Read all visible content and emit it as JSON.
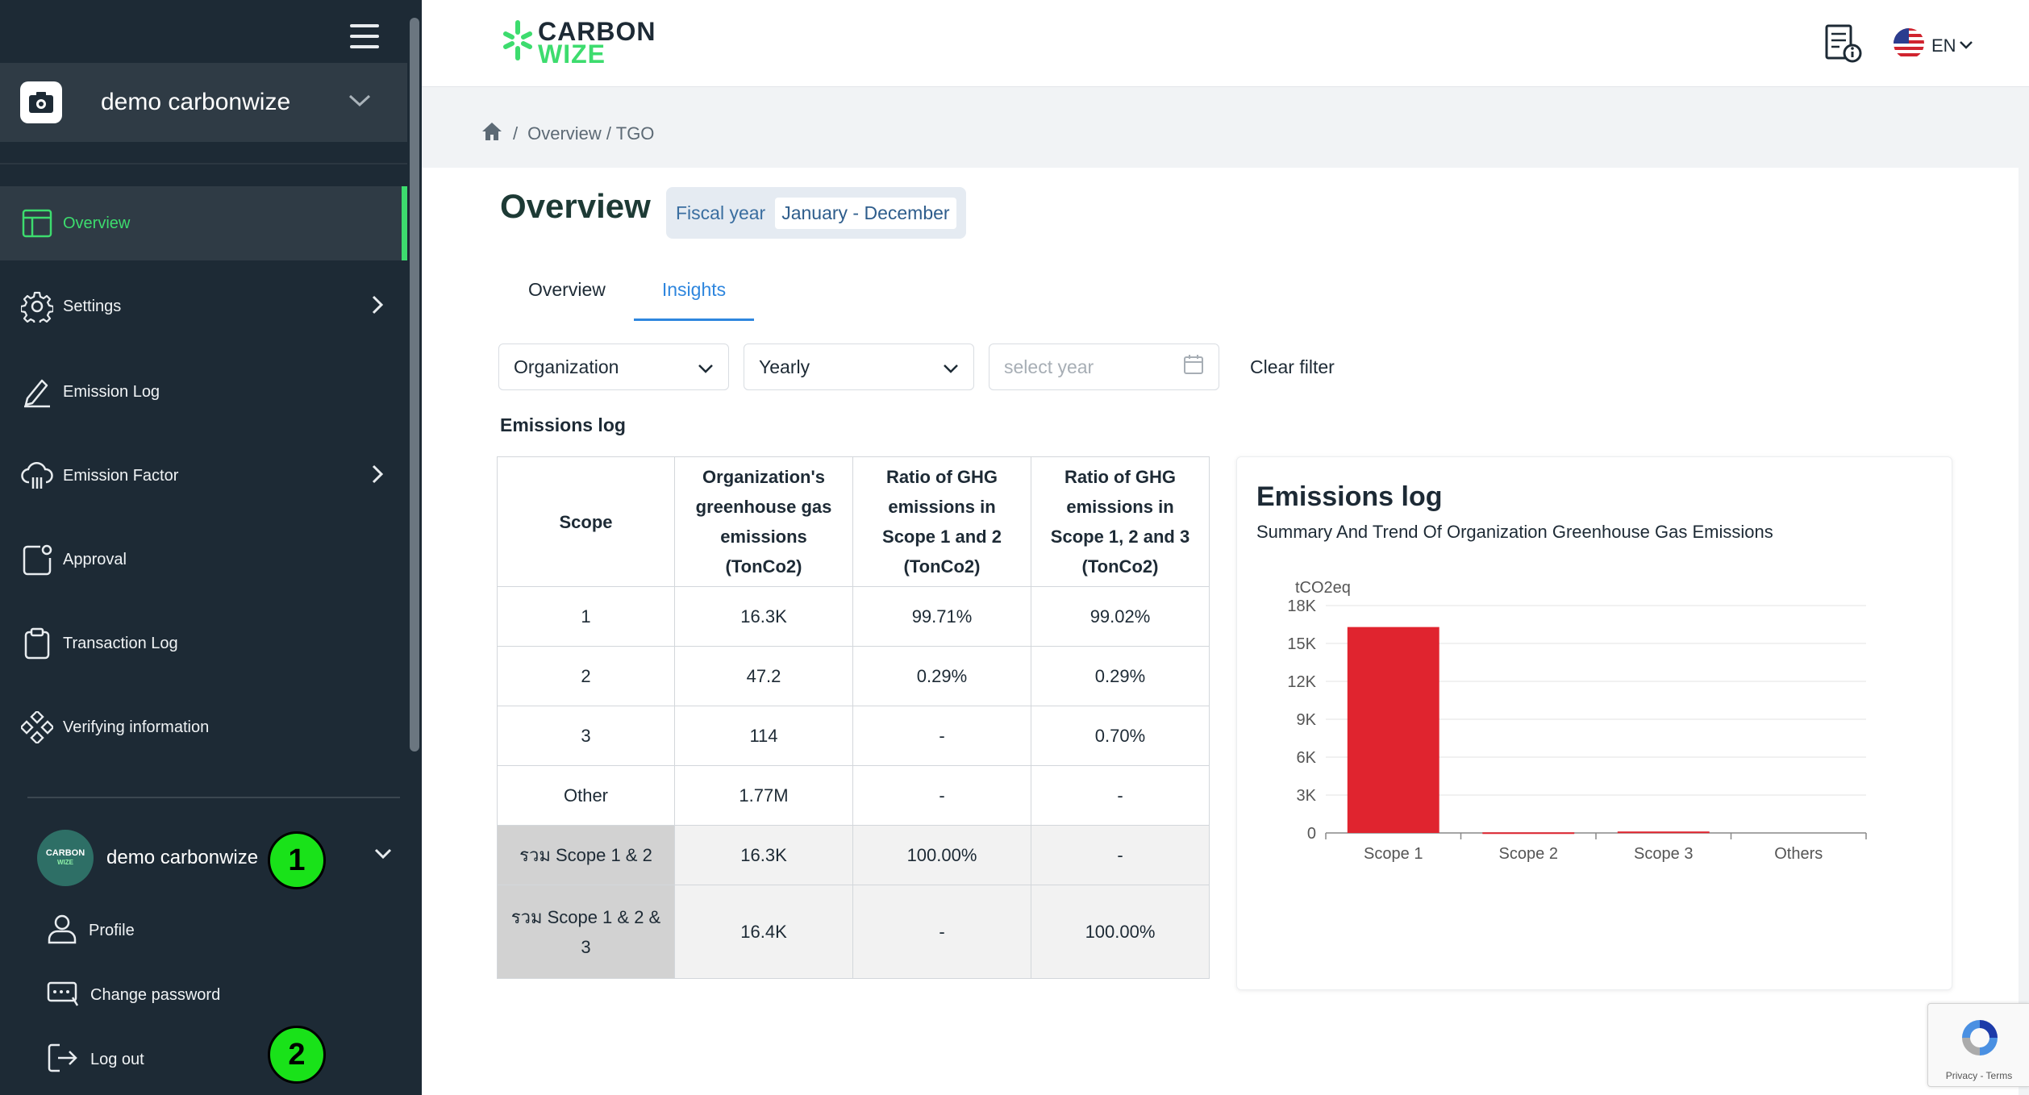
{
  "sidebar": {
    "org_name": "demo carbonwize",
    "nav": [
      {
        "label": "Overview",
        "icon": "layout-icon",
        "active": true
      },
      {
        "label": "Settings",
        "icon": "gear-icon",
        "arrow": true
      },
      {
        "label": "Emission Log",
        "icon": "pencil-icon"
      },
      {
        "label": "Emission Factor",
        "icon": "cloud-icon",
        "arrow": true
      },
      {
        "label": "Approval",
        "icon": "approval-icon"
      },
      {
        "label": "Transaction Log",
        "icon": "clipboard-icon"
      },
      {
        "label": "Verifying information",
        "icon": "diamonds-icon"
      }
    ],
    "user": {
      "name": "demo carbonwize",
      "avatar_text_top": "CARBON",
      "avatar_text_bottom": "WIZE"
    },
    "user_menu": [
      {
        "label": "Profile",
        "icon": "user-icon"
      },
      {
        "label": "Change password",
        "icon": "password-icon"
      },
      {
        "label": "Log out",
        "icon": "logout-icon"
      }
    ],
    "markers": [
      "1",
      "2"
    ]
  },
  "topbar": {
    "brand_line1": "CARBON",
    "brand_line2": "WIZE",
    "language": "EN"
  },
  "breadcrumb": {
    "path": "Overview / TGO"
  },
  "page": {
    "title": "Overview",
    "fiscal_label": "Fiscal year",
    "fiscal_value": "January - December",
    "tabs": [
      {
        "label": "Overview",
        "active": false
      },
      {
        "label": "Insights",
        "active": true
      }
    ],
    "filters": {
      "scope_select": "Organization",
      "period_select": "Yearly",
      "year_placeholder": "select year",
      "clear_filter": "Clear filter"
    },
    "section_label": "Emissions log"
  },
  "table": {
    "headers": [
      "Scope",
      "Organization's greenhouse gas emissions (TonCo2)",
      "Ratio of GHG emissions in Scope 1 and 2 (TonCo2)",
      "Ratio of GHG emissions in Scope 1, 2 and 3 (TonCo2)"
    ],
    "rows": [
      {
        "scope": "1",
        "emissions": "16.3K",
        "ratio12": "99.71%",
        "ratio123": "99.02%"
      },
      {
        "scope": "2",
        "emissions": "47.2",
        "ratio12": "0.29%",
        "ratio123": "0.29%"
      },
      {
        "scope": "3",
        "emissions": "114",
        "ratio12": "-",
        "ratio123": "0.70%"
      },
      {
        "scope": "Other",
        "emissions": "1.77M",
        "ratio12": "-",
        "ratio123": "-"
      },
      {
        "scope": "รวม Scope 1 & 2",
        "emissions": "16.3K",
        "ratio12": "100.00%",
        "ratio123": "-"
      },
      {
        "scope": "รวม Scope 1 & 2 & 3",
        "emissions": "16.4K",
        "ratio12": "-",
        "ratio123": "100.00%"
      }
    ]
  },
  "chart_card": {
    "title": "Emissions log",
    "subtitle": "Summary And Trend Of Organization Greenhouse Gas Emissions"
  },
  "chart_data": {
    "type": "bar",
    "ylabel": "tCO2eq",
    "categories": [
      "Scope 1",
      "Scope 2",
      "Scope 3",
      "Others"
    ],
    "values": [
      16300,
      47.2,
      114,
      0
    ],
    "ylim": [
      0,
      18000
    ],
    "yticks": [
      "0",
      "3K",
      "6K",
      "9K",
      "12K",
      "15K",
      "18K"
    ],
    "bar_color": "#e0242f",
    "grid": true
  },
  "recaptcha": {
    "text": "Privacy - Terms"
  },
  "colors": {
    "sidebar_bg": "#1d2a35",
    "accent": "#3ddc6e",
    "link_blue": "#2e86de"
  }
}
